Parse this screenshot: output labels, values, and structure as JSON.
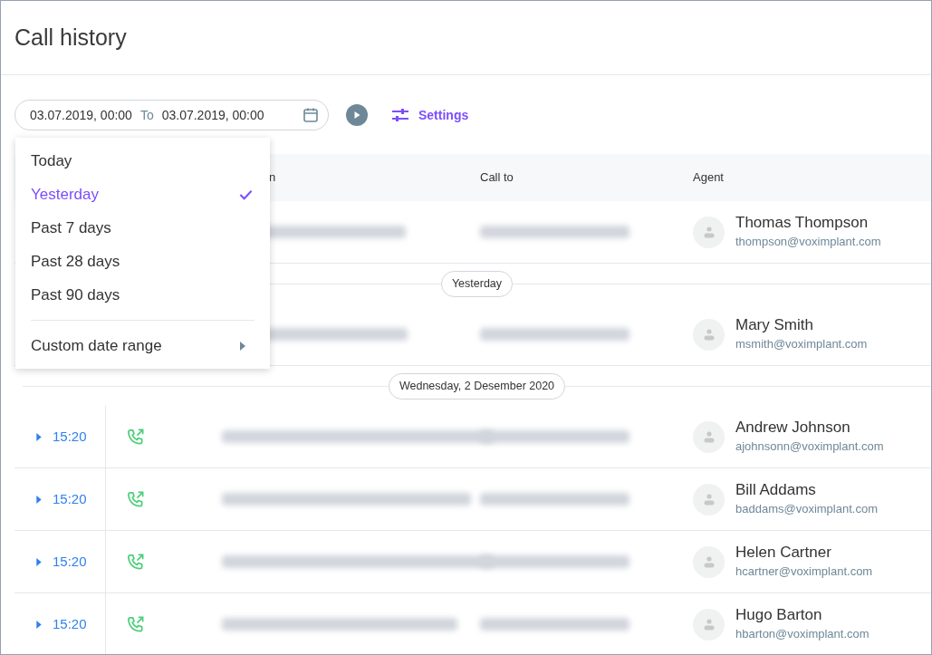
{
  "page": {
    "title": "Call history"
  },
  "filter": {
    "from": "03.07.2019, 00:00",
    "separator": "To",
    "to": "03.07.2019, 00:00",
    "settings_label": "Settings"
  },
  "table": {
    "columns": [
      "n",
      "Call to",
      "Agent"
    ],
    "groups": [
      {
        "rows": [
          {
            "agent_name": "Thomas Thompson",
            "agent_email": "thompson@voximplant.com"
          }
        ]
      },
      {
        "label": "Yesterday",
        "rows": [
          {
            "agent_name": "Mary Smith",
            "agent_email": "msmith@voximplant.com"
          }
        ]
      },
      {
        "label": "Wednesday, 2 Desember 2020",
        "rows": [
          {
            "time": "15:20",
            "kind": "outgoing",
            "agent_name": "Andrew Johnson",
            "agent_email": "ajohnsonn@voximplant.com"
          },
          {
            "time": "15:20",
            "kind": "outgoing",
            "agent_name": "Bill Addams",
            "agent_email": "baddams@voximplant.com"
          },
          {
            "time": "15:20",
            "kind": "outgoing",
            "agent_name": "Helen Cartner",
            "agent_email": "hcartner@voximplant.com"
          },
          {
            "time": "15:20",
            "kind": "outgoing",
            "agent_name": "Hugo Barton",
            "agent_email": "hbarton@voximplant.com"
          }
        ]
      }
    ]
  },
  "date_menu": {
    "items": [
      {
        "label": "Today",
        "selected": false
      },
      {
        "label": "Yesterday",
        "selected": true
      },
      {
        "label": "Past 7 days",
        "selected": false
      },
      {
        "label": "Past 28 days",
        "selected": false
      },
      {
        "label": "Past 90 days",
        "selected": false
      }
    ],
    "custom_label": "Custom date range"
  }
}
